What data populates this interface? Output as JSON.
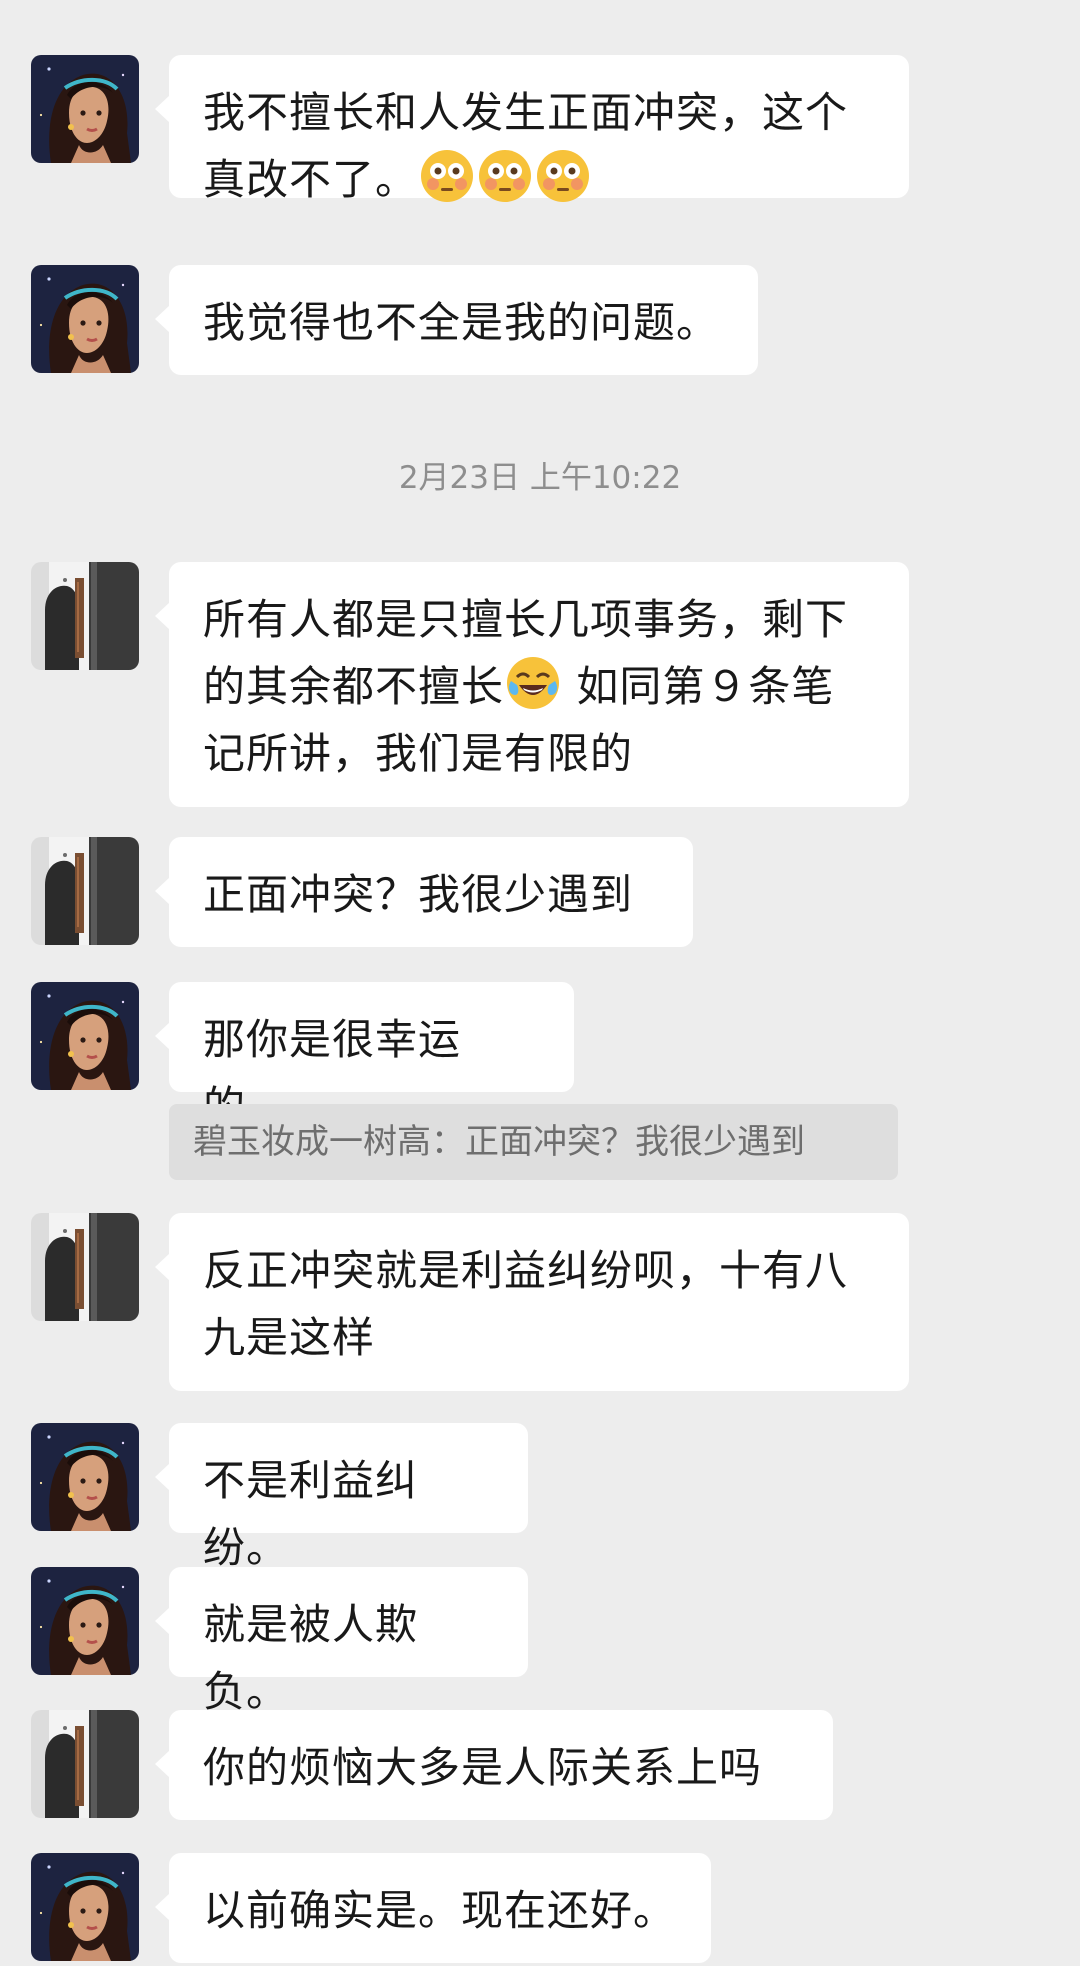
{
  "chat": {
    "timestamp": "2月23日 上午10:22",
    "messages": [
      {
        "sender": "girl",
        "parts": [
          "我不擅长和人发生正面冲突，这个\n真改不了。"
        ],
        "emoji": [
          "flushed-face",
          "flushed-face",
          "flushed-face"
        ]
      },
      {
        "sender": "girl",
        "parts": [
          "我觉得也不全是我的问题。"
        ]
      },
      {
        "sender": "boy",
        "parts": [
          "所有人都是只擅长几项事务，剩下\n的其余都不擅长",
          " 如同第９条笔\n记所讲，我们是有限的"
        ],
        "emoji": [
          "tears-of-joy-face"
        ]
      },
      {
        "sender": "boy",
        "parts": [
          "正面冲突？我很少遇到"
        ]
      },
      {
        "sender": "girl",
        "parts": [
          "那你是很幸运的。"
        ]
      },
      {
        "sender": "boy",
        "parts": [
          "反正冲突就是利益纠纷呗，十有八\n九是这样"
        ]
      },
      {
        "sender": "girl",
        "parts": [
          "不是利益纠纷。"
        ]
      },
      {
        "sender": "girl",
        "parts": [
          "就是被人欺负。"
        ]
      },
      {
        "sender": "boy",
        "parts": [
          "你的烦恼大多是人际关系上吗"
        ]
      },
      {
        "sender": "girl",
        "parts": [
          "以前确实是。现在还好。"
        ]
      }
    ],
    "quote": "碧玉妆成一树高：正面冲突？我很少遇到"
  },
  "colors": {
    "background": "#ededed",
    "bubble": "#ffffff",
    "text": "#191919",
    "timestamp": "#8e8e8e",
    "quote_bg": "#dedede",
    "quote_text": "#6e6e6e"
  }
}
